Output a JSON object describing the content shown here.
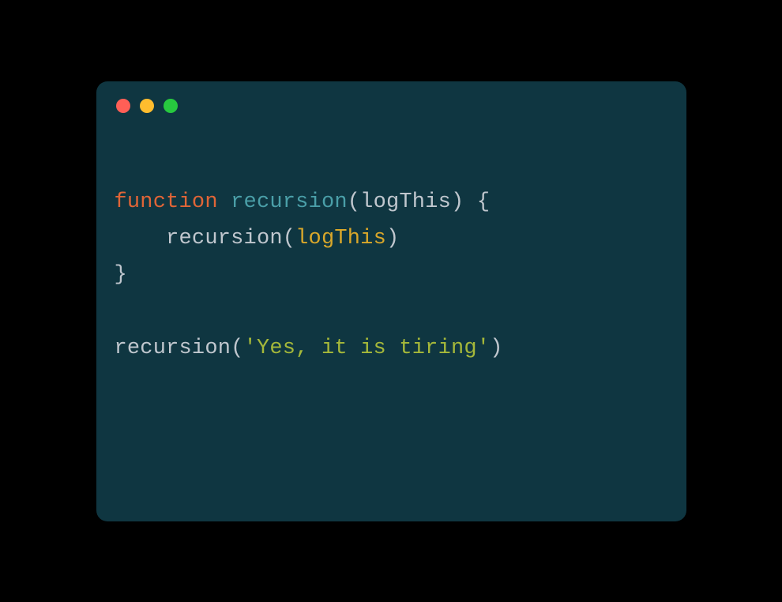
{
  "window": {
    "buttons": {
      "close": "close",
      "minimize": "minimize",
      "zoom": "zoom"
    }
  },
  "code": {
    "line1": {
      "keyword": "function",
      "space1": " ",
      "funcname": "recursion",
      "open_paren": "(",
      "param": "logThis",
      "close_paren": ")",
      "space2": " ",
      "open_brace": "{"
    },
    "line2": {
      "indent": "    ",
      "call": "recursion",
      "open_paren": "(",
      "arg": "logThis",
      "close_paren": ")"
    },
    "line3": {
      "close_brace": "}"
    },
    "line4": {
      "blank": ""
    },
    "line5": {
      "call": "recursion",
      "open_paren": "(",
      "string": "'Yes, it is tiring'",
      "close_paren": ")"
    }
  }
}
